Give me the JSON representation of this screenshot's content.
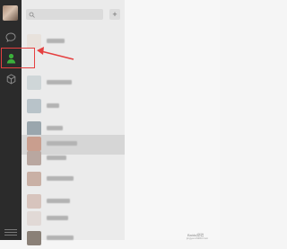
{
  "search": {
    "placeholder": ""
  },
  "plus_label": "+",
  "nav_icons": [
    "chat-bubble-icon",
    "contacts-icon",
    "favorites-cube-icon",
    "menu-icon"
  ],
  "contacts": [
    {
      "color": "#e8e2dc"
    },
    {
      "color": "#cfd6d8"
    },
    {
      "color": "#b8c3c9"
    },
    {
      "color": "#9aa6ad"
    },
    {
      "color": "#c99e8e"
    },
    {
      "color": "#b9a7a0"
    },
    {
      "color": "#c9b0a5"
    },
    {
      "color": "#d7c4bd"
    },
    {
      "color": "#e1d9d6"
    },
    {
      "color": "#8a8077"
    },
    {
      "color": "#6f685f"
    }
  ],
  "highlight_color": "#e54040",
  "watermark": {
    "line1": "Baidu经验",
    "line2": "jingyan.baidu.com"
  }
}
